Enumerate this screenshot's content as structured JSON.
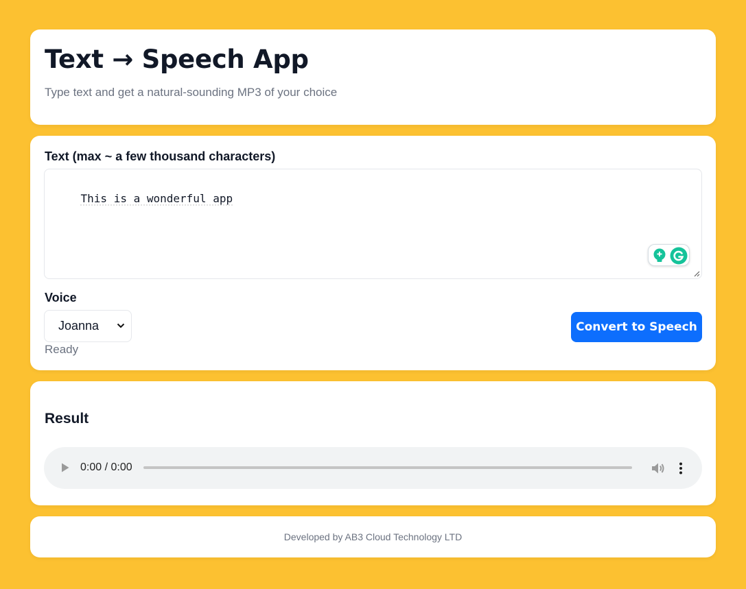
{
  "header": {
    "title": "Text → Speech App",
    "subtitle": "Type text and get a natural-sounding MP3 of your choice"
  },
  "form": {
    "text_label": "Text (max ~ a few thousand characters)",
    "text_value": "This is a wonderful app",
    "voice_label": "Voice",
    "voice_selected": "Joanna",
    "status": "Ready",
    "convert_button": "Convert to Speech"
  },
  "result": {
    "title": "Result",
    "audio_time": "0:00 / 0:00"
  },
  "footer": {
    "text": "Developed by AB3 Cloud Technology LTD"
  },
  "colors": {
    "background": "#fcc131",
    "accent": "#0d6efd",
    "grammarly": "#15c39a"
  },
  "icons": [
    "grammarly-bulb-icon",
    "grammarly-logo-icon",
    "chevron-down-icon",
    "play-icon",
    "volume-icon",
    "more-options-icon",
    "resize-handle-icon"
  ]
}
